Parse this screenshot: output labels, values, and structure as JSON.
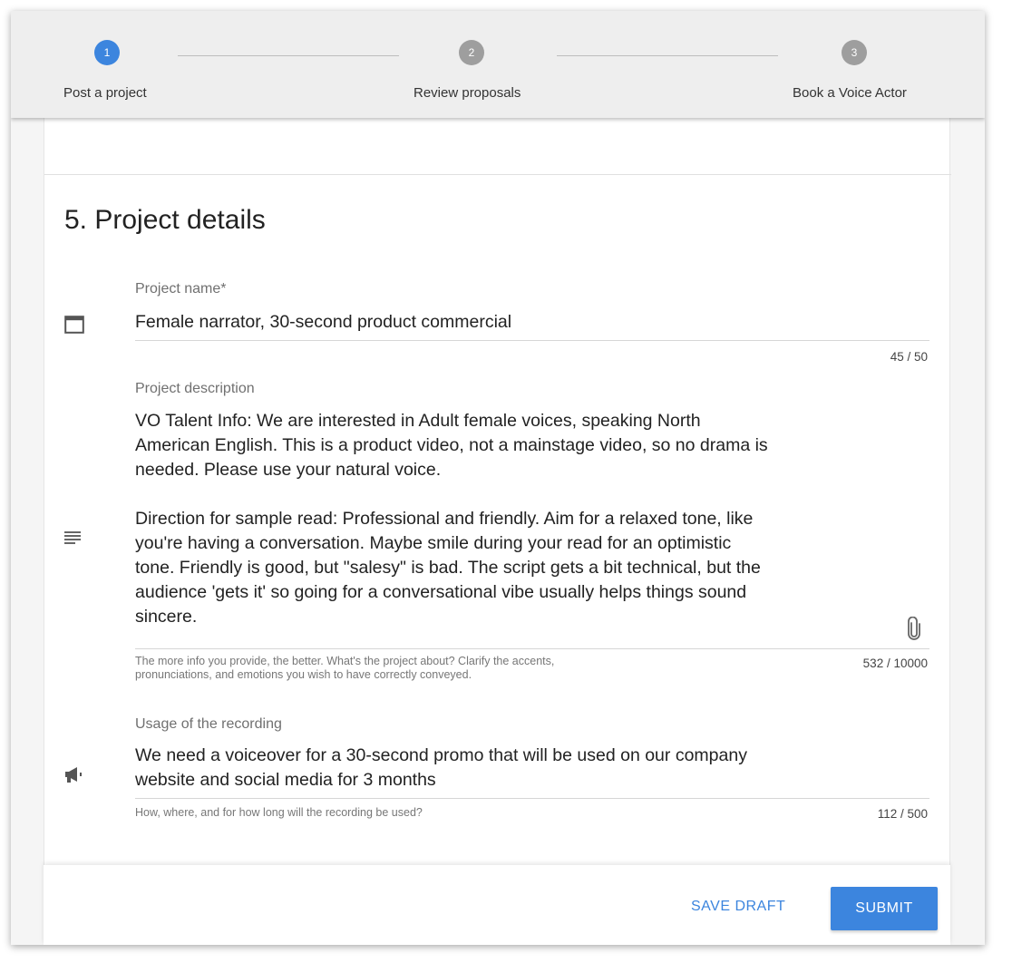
{
  "stepper": {
    "steps": [
      {
        "number": "1",
        "label": "Post a project",
        "active": true
      },
      {
        "number": "2",
        "label": "Review proposals",
        "active": false
      },
      {
        "number": "3",
        "label": "Book a Voice Actor",
        "active": false
      }
    ]
  },
  "section": {
    "title": "5. Project details"
  },
  "fields": {
    "project_name": {
      "label": "Project name*",
      "value": "Female narrator, 30-second product commercial",
      "counter": "45 / 50",
      "icon": "browser-window-icon"
    },
    "project_description": {
      "label": "Project description",
      "lines": [
        "VO Talent Info:  We are interested in Adult female voices, speaking North",
        "American English. This is a product video, not a mainstage video, so no drama is",
        "needed. Please use your natural voice.",
        "",
        "Direction for sample read: Professional and friendly. Aim for a relaxed tone, like",
        "you're having a conversation. Maybe smile during your read for an optimistic",
        "tone. Friendly is good, but \"salesy\" is bad. The script gets a bit technical, but the",
        "audience 'gets it' so going for a conversational vibe usually helps things sound",
        "sincere."
      ],
      "helper_lines": [
        "The more info you provide, the better. What's the project about? Clarify the accents,",
        "pronunciations, and emotions you wish to have correctly conveyed."
      ],
      "counter": "532 / 10000",
      "icon": "text-lines-icon",
      "attach_icon": "paperclip-icon"
    },
    "usage": {
      "label": "Usage of the recording",
      "lines": [
        "We need a voiceover for a 30-second promo that will be used on our company",
        "website and social media for 3 months"
      ],
      "helper": "How, where, and for how long will the recording be used?",
      "counter": "112 / 500",
      "icon": "megaphone-icon"
    }
  },
  "footer": {
    "save_draft_label": "SAVE DRAFT",
    "submit_label": "SUBMIT"
  },
  "colors": {
    "accent": "#3c85de",
    "inactive_step": "#9e9e9e"
  }
}
